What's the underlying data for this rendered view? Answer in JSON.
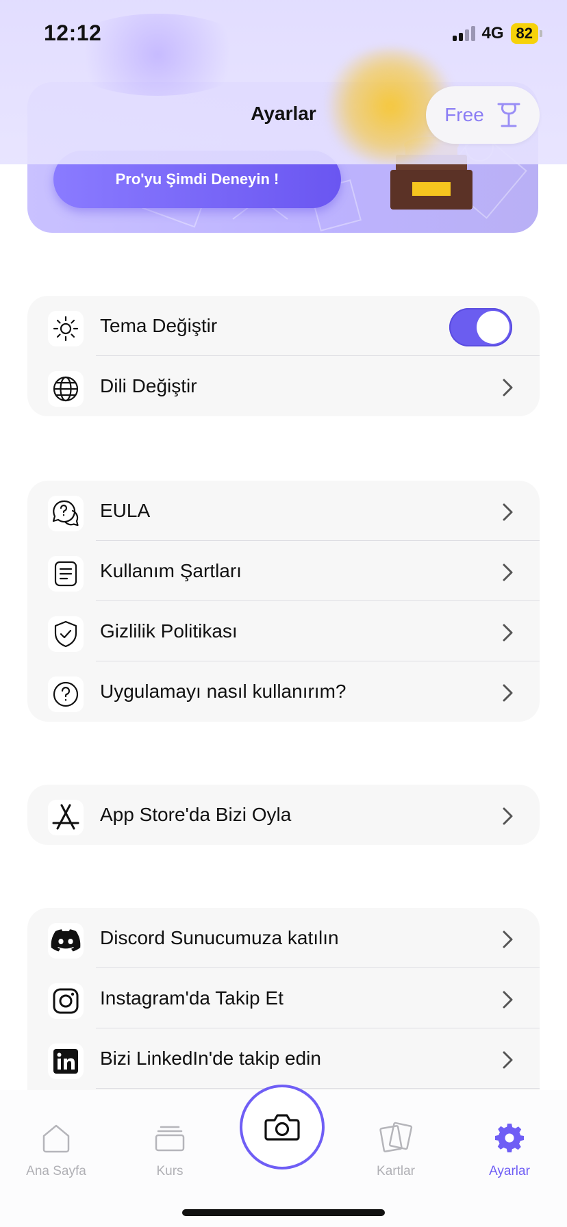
{
  "status_bar": {
    "time": "12:12",
    "network": "4G",
    "battery": "82"
  },
  "header": {
    "title": "Ayarlar",
    "plan_label": "Free"
  },
  "promo": {
    "button_label": "Pro'yu Şimdi Deneyin !"
  },
  "groups": [
    {
      "items": [
        {
          "label": "Tema Değiştir",
          "icon": "sun-icon",
          "toggle": true
        },
        {
          "label": "Dili Değiştir",
          "icon": "globe-icon"
        }
      ]
    },
    {
      "items": [
        {
          "label": "EULA",
          "icon": "help-chat-icon"
        },
        {
          "label": "Kullanım Şartları",
          "icon": "document-icon"
        },
        {
          "label": "Gizlilik Politikası",
          "icon": "shield-check-icon"
        },
        {
          "label": "Uygulamayı nasıl kullanırım?",
          "icon": "question-circle-icon"
        }
      ]
    },
    {
      "items": [
        {
          "label": "App Store'da Bizi Oyla",
          "icon": "app-store-icon"
        }
      ]
    },
    {
      "items": [
        {
          "label": "Discord Sunucumuza katılın",
          "icon": "discord-icon"
        },
        {
          "label": "Instagram'da Takip Et",
          "icon": "instagram-icon"
        },
        {
          "label": "Bizi LinkedIn'de takip edin",
          "icon": "linkedin-icon"
        }
      ]
    }
  ],
  "tabs": [
    {
      "label": "Ana Sayfa",
      "icon": "home-icon"
    },
    {
      "label": "Kurs",
      "icon": "stack-icon"
    },
    {
      "label": "Kartlar",
      "icon": "cards-icon"
    },
    {
      "label": "Ayarlar",
      "icon": "gear-icon",
      "active": true
    }
  ],
  "colors": {
    "accent": "#6f5ef5",
    "group_bg": "#f7f7f7",
    "battery": "#f6d20a"
  }
}
